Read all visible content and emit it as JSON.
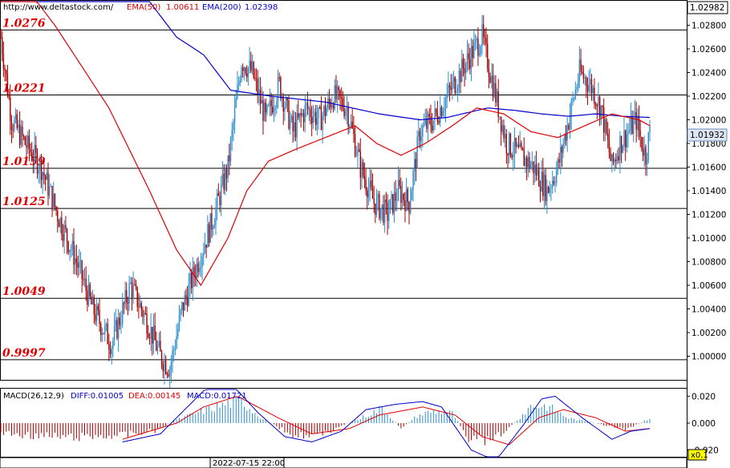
{
  "header": {
    "site": "http://www.deltastock.com/",
    "ema50_label": "EMA(50)",
    "ema50_value": "1.00611",
    "ema200_label": "EMA(200)",
    "ema200_value": "1.02398"
  },
  "macd_header": {
    "title": "MACD(26,12,9)",
    "diff": "DIFF:0.01005",
    "dea": "DEA:0.00145",
    "macd": "MACD:0.01721"
  },
  "price_panel": {
    "top_price": "1.02982",
    "current_price": "1.01932",
    "ylim": [
      0.998,
      1.03
    ],
    "y_ticks": [
      "1.02800",
      "1.02600",
      "1.02400",
      "1.02200",
      "1.02000",
      "1.01800",
      "1.01600",
      "1.01400",
      "1.01200",
      "1.01000",
      "1.00800",
      "1.00600",
      "1.00400",
      "1.00200",
      "1.00000"
    ],
    "levels": [
      "1.0276",
      "1.0221",
      "1.0159",
      "1.0125",
      "1.0049",
      "0.9997"
    ]
  },
  "macd_panel": {
    "ylim": [
      -0.025,
      0.025
    ],
    "y_ticks": [
      "0.020",
      "0.000",
      "-0.020"
    ]
  },
  "footer": {
    "date_label": "2022-07-15 22:00",
    "zoom_label": "x0.1"
  },
  "colors": {
    "bull": "#2a8fd0",
    "bear": "#a30000",
    "ema50": "#e00000",
    "ema200": "#0000cc",
    "level_text": "#e00000",
    "macd_diff": "#0000cc",
    "macd_dea": "#e00000"
  },
  "chart_data": [
    {
      "type": "candlestick",
      "price_anchors": [
        [
          0,
          1.027
        ],
        [
          8,
          1.02
        ],
        [
          18,
          1.018
        ],
        [
          30,
          1.016
        ],
        [
          42,
          1.012
        ],
        [
          56,
          1.008
        ],
        [
          68,
          1.004
        ],
        [
          82,
          1.001
        ],
        [
          96,
          1.006
        ],
        [
          108,
          1.003
        ],
        [
          118,
          1.0
        ],
        [
          125,
          0.999
        ],
        [
          134,
          1.004
        ],
        [
          146,
          1.008
        ],
        [
          158,
          1.012
        ],
        [
          168,
          1.016
        ],
        [
          178,
          1.025
        ],
        [
          186,
          1.024
        ],
        [
          196,
          1.02
        ],
        [
          206,
          1.023
        ],
        [
          216,
          1.019
        ],
        [
          226,
          1.021
        ],
        [
          236,
          1.02
        ],
        [
          246,
          1.022
        ],
        [
          256,
          1.021
        ],
        [
          266,
          1.016
        ],
        [
          276,
          1.013
        ],
        [
          286,
          1.012
        ],
        [
          294,
          1.014
        ],
        [
          302,
          1.013
        ],
        [
          310,
          1.019
        ],
        [
          320,
          1.02
        ],
        [
          330,
          1.022
        ],
        [
          340,
          1.024
        ],
        [
          350,
          1.026
        ],
        [
          356,
          1.027
        ],
        [
          364,
          1.023
        ],
        [
          374,
          1.018
        ],
        [
          384,
          1.017
        ],
        [
          394,
          1.016
        ],
        [
          404,
          1.014
        ],
        [
          412,
          1.016
        ],
        [
          420,
          1.02
        ],
        [
          428,
          1.024
        ],
        [
          436,
          1.023
        ],
        [
          444,
          1.021
        ],
        [
          452,
          1.016
        ],
        [
          458,
          1.018
        ],
        [
          464,
          1.019
        ],
        [
          470,
          1.02
        ],
        [
          474,
          1.018
        ],
        [
          477,
          1.017
        ],
        [
          480,
          1.019
        ]
      ],
      "ema50": [
        [
          0,
          1.034
        ],
        [
          40,
          1.028
        ],
        [
          80,
          1.021
        ],
        [
          110,
          1.014
        ],
        [
          130,
          1.009
        ],
        [
          148,
          1.006
        ],
        [
          168,
          1.01
        ],
        [
          182,
          1.014
        ],
        [
          198,
          1.0165
        ],
        [
          218,
          1.0175
        ],
        [
          240,
          1.0185
        ],
        [
          262,
          1.0195
        ],
        [
          278,
          1.018
        ],
        [
          296,
          1.017
        ],
        [
          314,
          1.018
        ],
        [
          334,
          1.0195
        ],
        [
          352,
          1.021
        ],
        [
          372,
          1.0205
        ],
        [
          392,
          1.019
        ],
        [
          412,
          1.0185
        ],
        [
          432,
          1.0195
        ],
        [
          452,
          1.0205
        ],
        [
          472,
          1.02
        ],
        [
          480,
          1.0195
        ]
      ],
      "ema200": [
        [
          0,
          1.042
        ],
        [
          40,
          1.04
        ],
        [
          80,
          1.035
        ],
        [
          110,
          1.03
        ],
        [
          130,
          1.027
        ],
        [
          150,
          1.0255
        ],
        [
          170,
          1.0225
        ],
        [
          200,
          1.022
        ],
        [
          240,
          1.0215
        ],
        [
          280,
          1.0205
        ],
        [
          310,
          1.02
        ],
        [
          330,
          1.0202
        ],
        [
          360,
          1.021
        ],
        [
          380,
          1.0208
        ],
        [
          400,
          1.0205
        ],
        [
          420,
          1.0203
        ],
        [
          440,
          1.0205
        ],
        [
          460,
          1.0203
        ],
        [
          480,
          1.0202
        ]
      ]
    },
    {
      "type": "macd",
      "hist_anchors": [
        [
          0,
          -0.008
        ],
        [
          20,
          -0.01
        ],
        [
          50,
          -0.012
        ],
        [
          90,
          -0.01
        ],
        [
          115,
          -0.006
        ],
        [
          128,
          0.002
        ],
        [
          150,
          0.01
        ],
        [
          168,
          0.016
        ],
        [
          178,
          0.018
        ],
        [
          192,
          0.005
        ],
        [
          206,
          -0.004
        ],
        [
          218,
          -0.01
        ],
        [
          236,
          -0.01
        ],
        [
          252,
          -0.002
        ],
        [
          264,
          0.003
        ],
        [
          282,
          0.012
        ],
        [
          296,
          -0.004
        ],
        [
          308,
          0.006
        ],
        [
          320,
          0.01
        ],
        [
          334,
          0.008
        ],
        [
          346,
          -0.012
        ],
        [
          362,
          -0.016
        ],
        [
          376,
          -0.004
        ],
        [
          392,
          0.014
        ],
        [
          404,
          0.014
        ],
        [
          420,
          0.004
        ],
        [
          440,
          0.0
        ],
        [
          462,
          -0.006
        ],
        [
          480,
          0.004
        ]
      ],
      "diff_anchors": [
        [
          90,
          -0.014
        ],
        [
          118,
          -0.008
        ],
        [
          136,
          0.01
        ],
        [
          150,
          0.024
        ],
        [
          168,
          0.032
        ],
        [
          190,
          0.008
        ],
        [
          210,
          -0.01
        ],
        [
          230,
          -0.014
        ],
        [
          252,
          -0.006
        ],
        [
          270,
          0.01
        ],
        [
          292,
          0.014
        ],
        [
          312,
          0.016
        ],
        [
          326,
          0.012
        ],
        [
          348,
          -0.02
        ],
        [
          366,
          -0.028
        ],
        [
          386,
          -0.002
        ],
        [
          400,
          0.018
        ],
        [
          410,
          0.02
        ],
        [
          430,
          0.004
        ],
        [
          452,
          -0.012
        ],
        [
          466,
          -0.006
        ],
        [
          480,
          -0.004
        ]
      ],
      "dea_anchors": [
        [
          90,
          -0.012
        ],
        [
          130,
          0.0
        ],
        [
          150,
          0.012
        ],
        [
          175,
          0.02
        ],
        [
          205,
          0.004
        ],
        [
          230,
          -0.008
        ],
        [
          258,
          -0.004
        ],
        [
          280,
          0.006
        ],
        [
          312,
          0.012
        ],
        [
          336,
          0.006
        ],
        [
          356,
          -0.01
        ],
        [
          376,
          -0.016
        ],
        [
          398,
          0.004
        ],
        [
          416,
          0.01
        ],
        [
          440,
          0.004
        ],
        [
          462,
          -0.006
        ],
        [
          480,
          -0.004
        ]
      ]
    }
  ]
}
